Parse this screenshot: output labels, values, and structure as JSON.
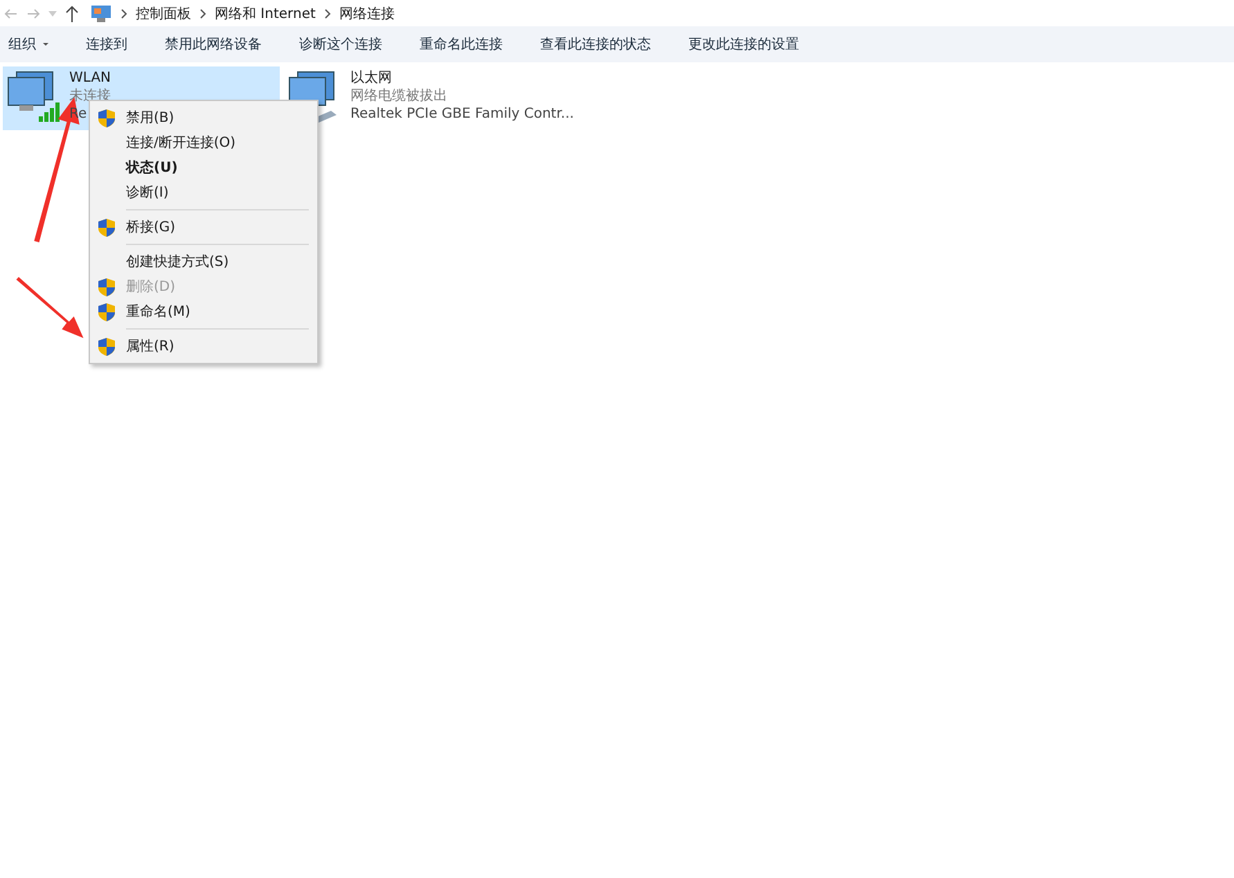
{
  "breadcrumb": [
    "控制面板",
    "网络和 Internet",
    "网络连接"
  ],
  "toolbar": [
    {
      "label": "组织",
      "dropdown": true
    },
    {
      "label": "连接到",
      "dropdown": false
    },
    {
      "label": "禁用此网络设备",
      "dropdown": false
    },
    {
      "label": "诊断这个连接",
      "dropdown": false
    },
    {
      "label": "重命名此连接",
      "dropdown": false
    },
    {
      "label": "查看此连接的状态",
      "dropdown": false
    },
    {
      "label": "更改此连接的设置",
      "dropdown": false
    }
  ],
  "connections": [
    {
      "name": "WLAN",
      "status": "未连接",
      "device": "Re",
      "kind": "wifi",
      "selected": true
    },
    {
      "name": "以太网",
      "status": "网络电缆被拔出",
      "device": "Realtek PCIe GBE Family Contr...",
      "kind": "ethernet",
      "selected": false
    }
  ],
  "context_menu": [
    {
      "kind": "item",
      "label": "禁用(B)",
      "shield": true,
      "bold": false,
      "disabled": false
    },
    {
      "kind": "item",
      "label": "连接/断开连接(O)",
      "shield": false,
      "bold": false,
      "disabled": false
    },
    {
      "kind": "item",
      "label": "状态(U)",
      "shield": false,
      "bold": true,
      "disabled": false
    },
    {
      "kind": "item",
      "label": "诊断(I)",
      "shield": false,
      "bold": false,
      "disabled": false
    },
    {
      "kind": "separator"
    },
    {
      "kind": "item",
      "label": "桥接(G)",
      "shield": true,
      "bold": false,
      "disabled": false
    },
    {
      "kind": "separator"
    },
    {
      "kind": "item",
      "label": "创建快捷方式(S)",
      "shield": false,
      "bold": false,
      "disabled": false
    },
    {
      "kind": "item",
      "label": "删除(D)",
      "shield": true,
      "bold": false,
      "disabled": true
    },
    {
      "kind": "item",
      "label": "重命名(M)",
      "shield": true,
      "bold": false,
      "disabled": false
    },
    {
      "kind": "separator"
    },
    {
      "kind": "item",
      "label": "属性(R)",
      "shield": true,
      "bold": false,
      "disabled": false
    }
  ]
}
